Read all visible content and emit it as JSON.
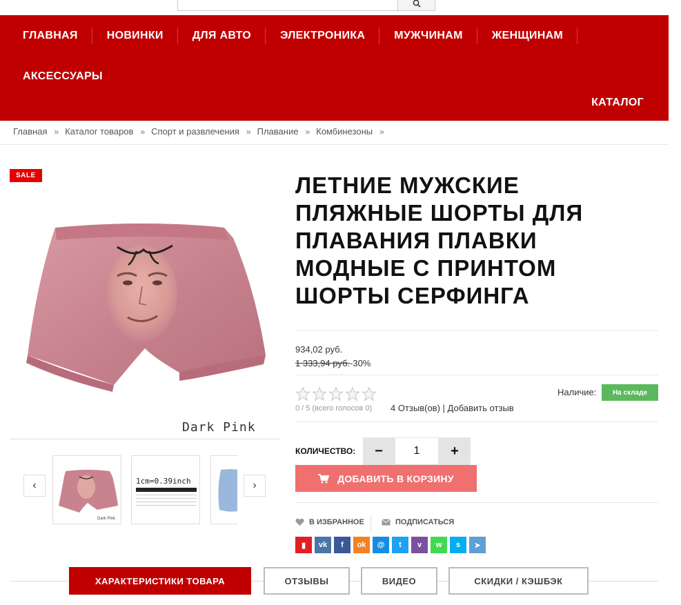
{
  "search": {
    "placeholder": "",
    "button_icon": "search-icon"
  },
  "nav": {
    "items": [
      "ГЛАВНАЯ",
      "НОВИНКИ",
      "ДЛЯ АВТО",
      "ЭЛЕКТРОНИКА",
      "МУЖЧИНАМ",
      "ЖЕНЩИНАМ"
    ],
    "row2": [
      "АКСЕССУАРЫ"
    ],
    "catalog": "КАТАЛОГ",
    "bg_color": "#c00000"
  },
  "breadcrumb": [
    "Главная",
    "Каталог товаров",
    "Спорт и развлечения",
    "Плавание",
    "Комбинезоны"
  ],
  "breadcrumb_sep": "»",
  "product": {
    "sale_badge": "SALE",
    "image_caption": "Dark Pink",
    "thumb1_caption": "Dark Pink",
    "thumb2_caption": "1cm=0.39inch",
    "title": "ЛЕТНИЕ МУЖСКИЕ ПЛЯЖНЫЕ ШОРТЫ ДЛЯ ПЛАВАНИЯ ПЛАВКИ МОДНЫЕ С ПРИНТОМ ШОРТЫ СЕРФИНГА",
    "price": "934,02 руб.",
    "old_price": "1 333,94 руб.",
    "discount": "-30%",
    "rating": {
      "value": 0,
      "max": 5
    },
    "votes": "0 / 5 (всего голосов 0)",
    "reviews_link": "4 Отзыв(ов)",
    "reviews_sep": " | ",
    "add_review_link": "Добавить отзыв",
    "availability_label": "Наличие:",
    "availability_status": "На складе",
    "availability_color": "#5cb85c",
    "quantity_label": "КОЛИЧЕСТВО:",
    "quantity_value": "1",
    "minus": "−",
    "plus": "+",
    "add_to_cart": "ДОБАВИТЬ В КОРЗИНУ",
    "add_to_cart_color": "#f07070",
    "wishlist": "В ИЗБРАННОЕ",
    "subscribe": "ПОДПИСАТЬСЯ"
  },
  "social": [
    {
      "name": "bookmark",
      "glyph": "▮",
      "color": "#e31e24"
    },
    {
      "name": "vk",
      "glyph": "vk",
      "color": "#4a76a8"
    },
    {
      "name": "facebook",
      "glyph": "f",
      "color": "#3b5998"
    },
    {
      "name": "odnoklassniki",
      "glyph": "ok",
      "color": "#f58220"
    },
    {
      "name": "moimir",
      "glyph": "@",
      "color": "#168de2"
    },
    {
      "name": "twitter",
      "glyph": "t",
      "color": "#1da1f2"
    },
    {
      "name": "viber",
      "glyph": "v",
      "color": "#7b519d"
    },
    {
      "name": "whatsapp",
      "glyph": "w",
      "color": "#43d854"
    },
    {
      "name": "skype",
      "glyph": "s",
      "color": "#00aff0"
    },
    {
      "name": "telegram",
      "glyph": "➤",
      "color": "#5d9fd6"
    }
  ],
  "tabs": [
    "ХАРАКТЕРИСТИКИ ТОВАРА",
    "ОТЗЫВЫ",
    "ВИДЕО",
    "СКИДКИ / КЭШБЭК"
  ],
  "thumb_nav": {
    "prev": "‹",
    "next": "›"
  }
}
